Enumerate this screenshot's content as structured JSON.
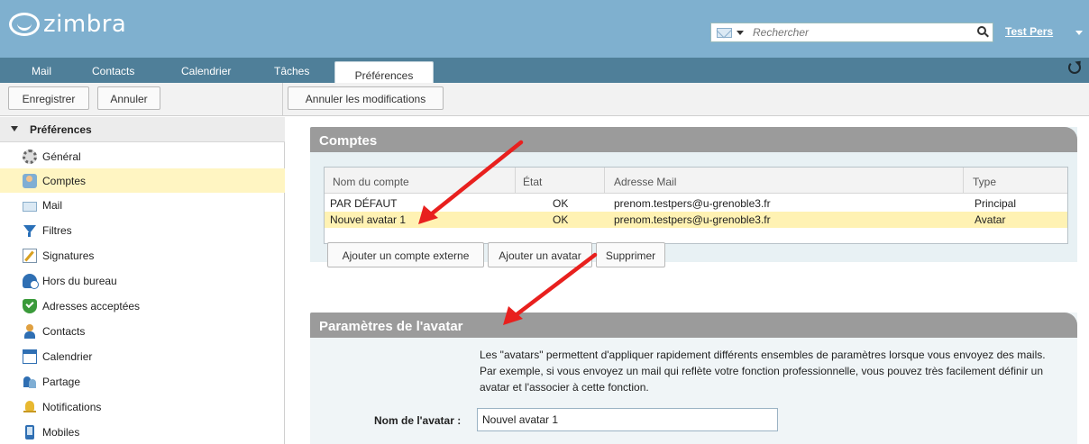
{
  "header": {
    "brand": "zimbra",
    "search": {
      "placeholder": "Rechercher"
    },
    "user": "Test Pers"
  },
  "tabs": [
    {
      "label": "Mail"
    },
    {
      "label": "Contacts"
    },
    {
      "label": "Calendrier"
    },
    {
      "label": "Tâches"
    },
    {
      "label": "Préférences",
      "active": true
    }
  ],
  "toolbar": {
    "save": "Enregistrer",
    "cancel": "Annuler",
    "revert": "Annuler les modifications"
  },
  "sidebar": {
    "title": "Préférences",
    "items": [
      {
        "label": "Général",
        "icon": "gear-icon"
      },
      {
        "label": "Comptes",
        "icon": "accounts-icon",
        "selected": true
      },
      {
        "label": "Mail",
        "icon": "mail-icon"
      },
      {
        "label": "Filtres",
        "icon": "filter-icon"
      },
      {
        "label": "Signatures",
        "icon": "signature-icon"
      },
      {
        "label": "Hors du bureau",
        "icon": "out-of-office-icon"
      },
      {
        "label": "Adresses acceptées",
        "icon": "shield-check-icon"
      },
      {
        "label": "Contacts",
        "icon": "contact-icon"
      },
      {
        "label": "Calendrier",
        "icon": "calendar-icon"
      },
      {
        "label": "Partage",
        "icon": "share-icon"
      },
      {
        "label": "Notifications",
        "icon": "bell-icon"
      },
      {
        "label": "Mobiles",
        "icon": "mobile-icon"
      }
    ]
  },
  "accounts": {
    "title": "Comptes",
    "columns": [
      "Nom du compte",
      "État",
      "Adresse Mail",
      "Type"
    ],
    "rows": [
      {
        "name": "PAR DÉFAUT",
        "status": "OK",
        "email": "prenom.testpers@u-grenoble3.fr",
        "type": "Principal",
        "selected": false
      },
      {
        "name": "Nouvel avatar 1",
        "status": "OK",
        "email": "prenom.testpers@u-grenoble3.fr",
        "type": "Avatar",
        "selected": true
      }
    ],
    "buttons": {
      "add_external": "Ajouter un compte externe",
      "add_avatar": "Ajouter un avatar",
      "delete": "Supprimer"
    }
  },
  "avatar_settings": {
    "title": "Paramètres de l'avatar",
    "description": "Les \"avatars\" permettent d'appliquer rapidement différents ensembles de paramètres lorsque vous envoyez des mails. Par exemple, si vous envoyez un mail qui reflète votre fonction professionnelle, vous pouvez très facilement définir un avatar et l'associer à cette fonction.",
    "name_label": "Nom de l'avatar :",
    "name_value": "Nouvel avatar 1"
  },
  "colors": {
    "topbar": "#7fb0cf",
    "tabbar": "#4f7f99",
    "section_header": "#9b9b9b",
    "selection": "#fff5c2",
    "annotation_arrow": "#e8201e"
  }
}
